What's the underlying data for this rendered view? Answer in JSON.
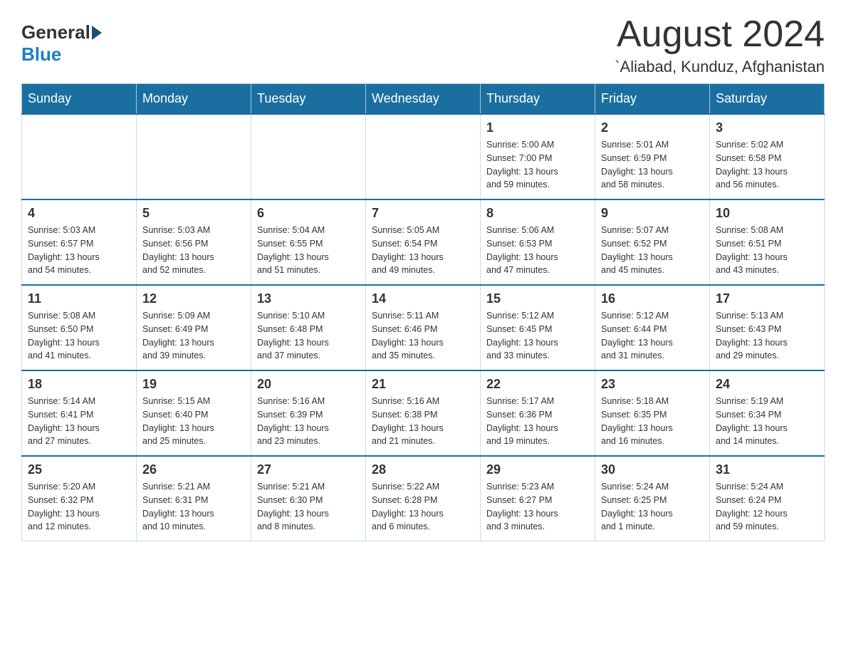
{
  "header": {
    "logo_general": "General",
    "logo_blue": "Blue",
    "month_title": "August 2024",
    "location": "`Aliabad, Kunduz, Afghanistan"
  },
  "days_of_week": [
    "Sunday",
    "Monday",
    "Tuesday",
    "Wednesday",
    "Thursday",
    "Friday",
    "Saturday"
  ],
  "weeks": [
    [
      {
        "day": "",
        "info": ""
      },
      {
        "day": "",
        "info": ""
      },
      {
        "day": "",
        "info": ""
      },
      {
        "day": "",
        "info": ""
      },
      {
        "day": "1",
        "info": "Sunrise: 5:00 AM\nSunset: 7:00 PM\nDaylight: 13 hours\nand 59 minutes."
      },
      {
        "day": "2",
        "info": "Sunrise: 5:01 AM\nSunset: 6:59 PM\nDaylight: 13 hours\nand 58 minutes."
      },
      {
        "day": "3",
        "info": "Sunrise: 5:02 AM\nSunset: 6:58 PM\nDaylight: 13 hours\nand 56 minutes."
      }
    ],
    [
      {
        "day": "4",
        "info": "Sunrise: 5:03 AM\nSunset: 6:57 PM\nDaylight: 13 hours\nand 54 minutes."
      },
      {
        "day": "5",
        "info": "Sunrise: 5:03 AM\nSunset: 6:56 PM\nDaylight: 13 hours\nand 52 minutes."
      },
      {
        "day": "6",
        "info": "Sunrise: 5:04 AM\nSunset: 6:55 PM\nDaylight: 13 hours\nand 51 minutes."
      },
      {
        "day": "7",
        "info": "Sunrise: 5:05 AM\nSunset: 6:54 PM\nDaylight: 13 hours\nand 49 minutes."
      },
      {
        "day": "8",
        "info": "Sunrise: 5:06 AM\nSunset: 6:53 PM\nDaylight: 13 hours\nand 47 minutes."
      },
      {
        "day": "9",
        "info": "Sunrise: 5:07 AM\nSunset: 6:52 PM\nDaylight: 13 hours\nand 45 minutes."
      },
      {
        "day": "10",
        "info": "Sunrise: 5:08 AM\nSunset: 6:51 PM\nDaylight: 13 hours\nand 43 minutes."
      }
    ],
    [
      {
        "day": "11",
        "info": "Sunrise: 5:08 AM\nSunset: 6:50 PM\nDaylight: 13 hours\nand 41 minutes."
      },
      {
        "day": "12",
        "info": "Sunrise: 5:09 AM\nSunset: 6:49 PM\nDaylight: 13 hours\nand 39 minutes."
      },
      {
        "day": "13",
        "info": "Sunrise: 5:10 AM\nSunset: 6:48 PM\nDaylight: 13 hours\nand 37 minutes."
      },
      {
        "day": "14",
        "info": "Sunrise: 5:11 AM\nSunset: 6:46 PM\nDaylight: 13 hours\nand 35 minutes."
      },
      {
        "day": "15",
        "info": "Sunrise: 5:12 AM\nSunset: 6:45 PM\nDaylight: 13 hours\nand 33 minutes."
      },
      {
        "day": "16",
        "info": "Sunrise: 5:12 AM\nSunset: 6:44 PM\nDaylight: 13 hours\nand 31 minutes."
      },
      {
        "day": "17",
        "info": "Sunrise: 5:13 AM\nSunset: 6:43 PM\nDaylight: 13 hours\nand 29 minutes."
      }
    ],
    [
      {
        "day": "18",
        "info": "Sunrise: 5:14 AM\nSunset: 6:41 PM\nDaylight: 13 hours\nand 27 minutes."
      },
      {
        "day": "19",
        "info": "Sunrise: 5:15 AM\nSunset: 6:40 PM\nDaylight: 13 hours\nand 25 minutes."
      },
      {
        "day": "20",
        "info": "Sunrise: 5:16 AM\nSunset: 6:39 PM\nDaylight: 13 hours\nand 23 minutes."
      },
      {
        "day": "21",
        "info": "Sunrise: 5:16 AM\nSunset: 6:38 PM\nDaylight: 13 hours\nand 21 minutes."
      },
      {
        "day": "22",
        "info": "Sunrise: 5:17 AM\nSunset: 6:36 PM\nDaylight: 13 hours\nand 19 minutes."
      },
      {
        "day": "23",
        "info": "Sunrise: 5:18 AM\nSunset: 6:35 PM\nDaylight: 13 hours\nand 16 minutes."
      },
      {
        "day": "24",
        "info": "Sunrise: 5:19 AM\nSunset: 6:34 PM\nDaylight: 13 hours\nand 14 minutes."
      }
    ],
    [
      {
        "day": "25",
        "info": "Sunrise: 5:20 AM\nSunset: 6:32 PM\nDaylight: 13 hours\nand 12 minutes."
      },
      {
        "day": "26",
        "info": "Sunrise: 5:21 AM\nSunset: 6:31 PM\nDaylight: 13 hours\nand 10 minutes."
      },
      {
        "day": "27",
        "info": "Sunrise: 5:21 AM\nSunset: 6:30 PM\nDaylight: 13 hours\nand 8 minutes."
      },
      {
        "day": "28",
        "info": "Sunrise: 5:22 AM\nSunset: 6:28 PM\nDaylight: 13 hours\nand 6 minutes."
      },
      {
        "day": "29",
        "info": "Sunrise: 5:23 AM\nSunset: 6:27 PM\nDaylight: 13 hours\nand 3 minutes."
      },
      {
        "day": "30",
        "info": "Sunrise: 5:24 AM\nSunset: 6:25 PM\nDaylight: 13 hours\nand 1 minute."
      },
      {
        "day": "31",
        "info": "Sunrise: 5:24 AM\nSunset: 6:24 PM\nDaylight: 12 hours\nand 59 minutes."
      }
    ]
  ]
}
